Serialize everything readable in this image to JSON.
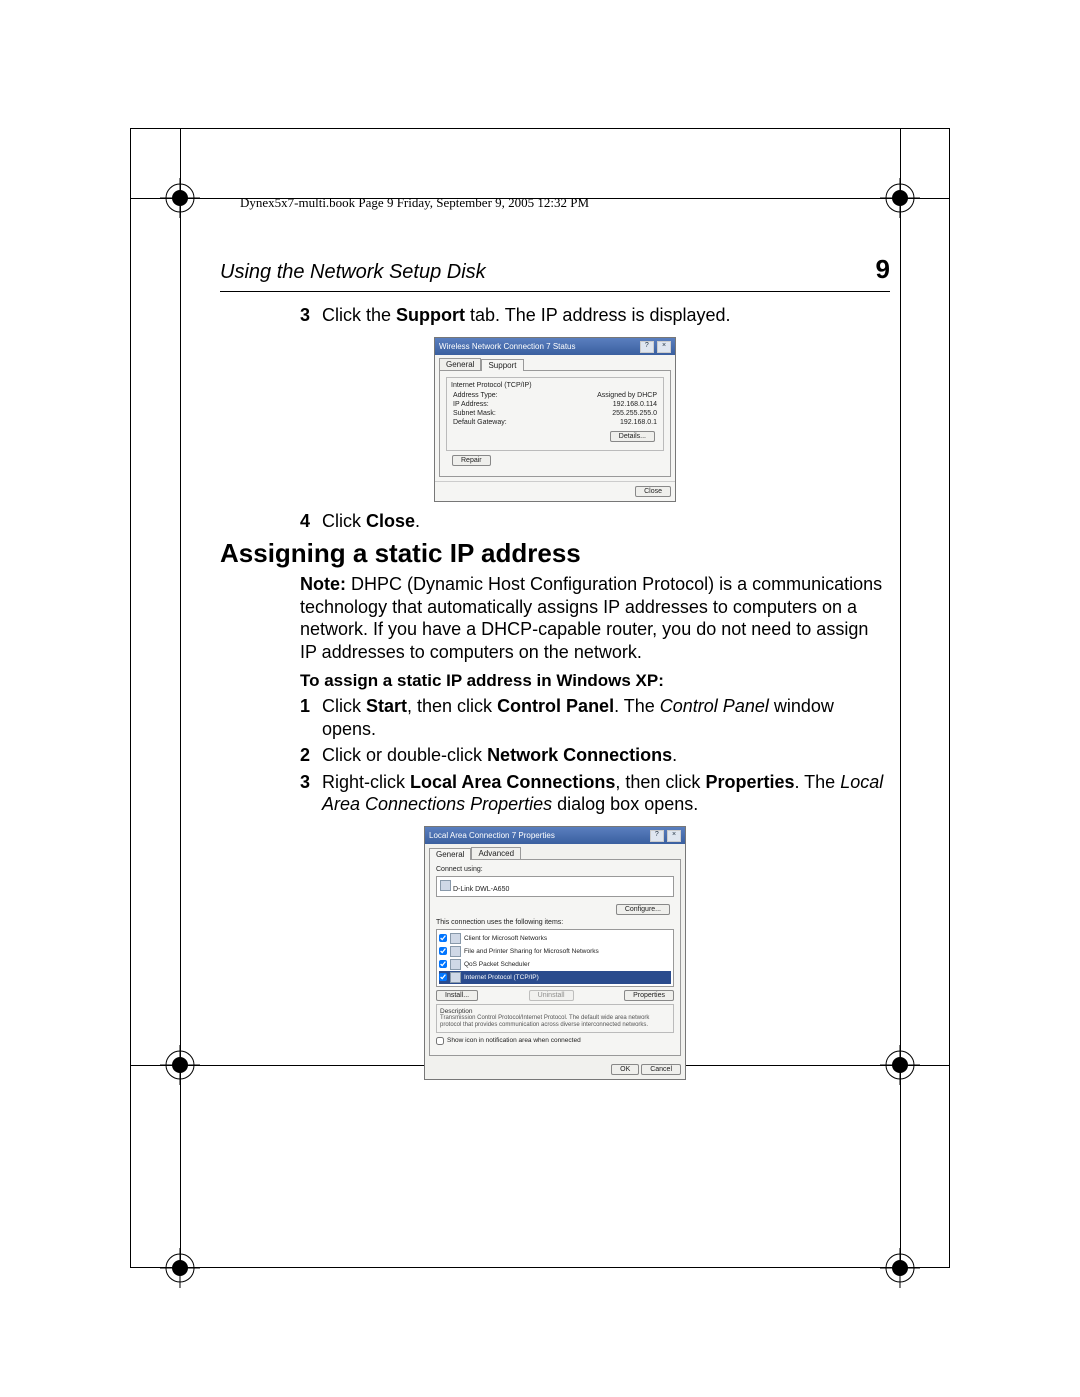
{
  "book_header": "Dynex5x7-multi.book  Page 9  Friday, September 9, 2005  12:32 PM",
  "running_head": {
    "title": "Using the Network Setup Disk",
    "page": "9"
  },
  "step3": {
    "num": "3",
    "pre": "Click the ",
    "bold": "Support",
    "post": " tab. The IP address is displayed."
  },
  "shot1": {
    "title": "Wireless Network Connection 7 Status",
    "tab_general": "General",
    "tab_support": "Support",
    "group": "Internet Protocol (TCP/IP)",
    "rows": {
      "addr_type_k": "Address Type:",
      "addr_type_v": "Assigned by DHCP",
      "ip_k": "IP Address:",
      "ip_v": "192.168.0.114",
      "mask_k": "Subnet Mask:",
      "mask_v": "255.255.255.0",
      "gw_k": "Default Gateway:",
      "gw_v": "192.168.0.1"
    },
    "details_btn": "Details...",
    "repair_btn": "Repair",
    "close_btn": "Close"
  },
  "step4": {
    "num": "4",
    "pre": "Click ",
    "bold": "Close",
    "post": "."
  },
  "heading": "Assigning a static IP address",
  "note": {
    "label": "Note: ",
    "body": "DHPC (Dynamic Host Configuration Protocol) is a communications technology that automatically assigns IP addresses to computers on a network. If you have a DHCP-capable router, you do not need to assign IP addresses to computers on the network."
  },
  "subhead": "To assign a static IP address in Windows XP:",
  "s1": {
    "num": "1",
    "a": "Click ",
    "b1": "Start",
    "c": ", then click ",
    "b2": "Control Panel",
    "d": ". The ",
    "i1": "Control Panel",
    "e": " window opens."
  },
  "s2": {
    "num": "2",
    "a": "Click or double-click ",
    "b1": "Network Connections",
    "c": "."
  },
  "s3": {
    "num": "3",
    "a": "Right-click ",
    "b1": "Local Area Connections",
    "c": ", then click ",
    "b2": "Properties",
    "d": ". The ",
    "i1": "Local Area Connections Properties",
    "e": " dialog box opens."
  },
  "shot2": {
    "title": "Local Area Connection 7 Properties",
    "tab_general": "General",
    "tab_advanced": "Advanced",
    "connect_using": "Connect using:",
    "adapter": "D-Link DWL-A650",
    "configure": "Configure...",
    "uses_label": "This connection uses the following items:",
    "items": {
      "i0": "Client for Microsoft Networks",
      "i1": "File and Printer Sharing for Microsoft Networks",
      "i2": "QoS Packet Scheduler",
      "i3": "Internet Protocol (TCP/IP)"
    },
    "install": "Install...",
    "uninstall": "Uninstall",
    "properties": "Properties",
    "desc_label": "Description",
    "desc_body": "Transmission Control Protocol/Internet Protocol. The default wide area network protocol that provides communication across diverse interconnected networks.",
    "show_icon": "Show icon in notification area when connected",
    "ok": "OK",
    "cancel": "Cancel"
  }
}
